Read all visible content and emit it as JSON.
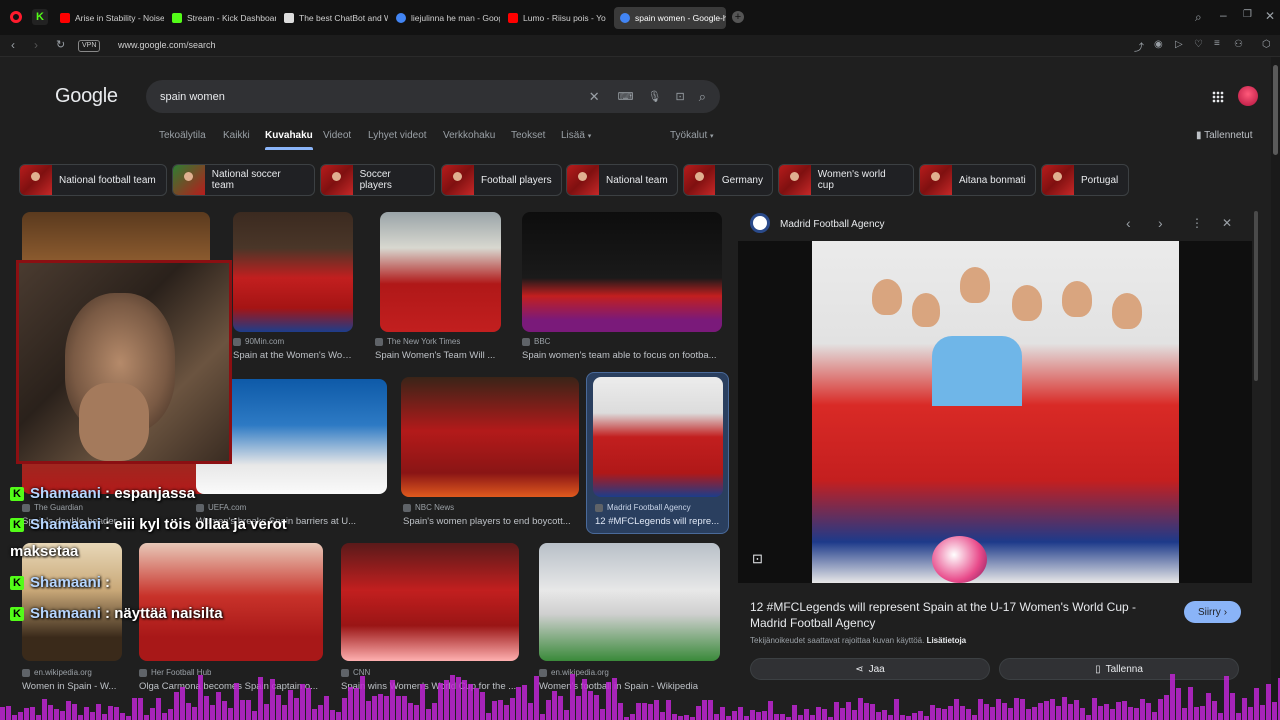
{
  "browser": {
    "tabs": [
      {
        "label": "Arise in Stability - Noise H",
        "color": "#ff0000"
      },
      {
        "label": "Stream - Kick Dashboard",
        "color": "#53fc18"
      },
      {
        "label": "The best ChatBot and Wi",
        "color": "#ffffff"
      },
      {
        "label": "liejulinna he man - Googl",
        "color": "#4285f4"
      },
      {
        "label": "Lumo - Riisu pois - Yo",
        "color": "#ff0000"
      },
      {
        "label": "spain women - Google-h",
        "color": "#4285f4"
      }
    ],
    "url": "www.google.com/search",
    "vpn": "VPN"
  },
  "google": {
    "logo": "Google",
    "query": "spain women",
    "nav_tabs": [
      "Tekoälytila",
      "Kaikki",
      "Kuvahaku",
      "Videot",
      "Lyhyet videot",
      "Verkkohaku",
      "Teokset",
      "Lisää"
    ],
    "tools": "Työkalut",
    "saved": "Tallennetut",
    "chips": [
      "National football team",
      "National soccer team",
      "Soccer players",
      "Football players",
      "National team",
      "Germany",
      "Women's world cup",
      "Aitana bonmati",
      "Portugal"
    ]
  },
  "results": [
    {
      "source": "90Min.com",
      "title": "Spain at the Women's Worl..."
    },
    {
      "source": "The New York Times",
      "title": "Spain Women's Team Will ..."
    },
    {
      "source": "BBC",
      "title": "Spain women's team able to focus on footba..."
    },
    {
      "source": "The Guardian",
      "title": "Spain's double-header..."
    },
    {
      "source": "UEFA.com",
      "title": "Women's breaks Spain barriers at U..."
    },
    {
      "source": "NBC News",
      "title": "Spain's women players to end boycott..."
    },
    {
      "source": "Madrid Football Agency",
      "title": "12 #MFCLegends will repre..."
    },
    {
      "source": "en.wikipedia.org",
      "title": "Women in Spain - W..."
    },
    {
      "source": "Her Football Hub",
      "title": "Olga Carmona becomes Spain captain o..."
    },
    {
      "source": "CNN",
      "title": "Spain wins Women's World Cup for the ..."
    },
    {
      "source": "en.wikipedia.org",
      "title": "Women's football in Spain - Wikipedia"
    }
  ],
  "panel": {
    "source": "Madrid Football Agency",
    "title": "12 #MFCLegends will represent Spain at the U-17 Women's World Cup - Madrid Football Agency",
    "visit": "Siirry",
    "copyright": "Tekijänoikeudet saattavat rajoittaa kuvan käyttöä.",
    "more_info": "Lisätietoja",
    "share": "Jaa",
    "save": "Tallenna"
  },
  "chat": [
    {
      "user": "Shamaani",
      "msg": "espanjassa"
    },
    {
      "user": "Shamaani",
      "msg": "eiii kyl töis ollaa ja verot"
    },
    {
      "user": "",
      "msg": "maksetaa"
    },
    {
      "user": "Shamaani",
      "msg": ""
    },
    {
      "user": "Shamaani",
      "msg": "näyttää naisilta"
    }
  ]
}
